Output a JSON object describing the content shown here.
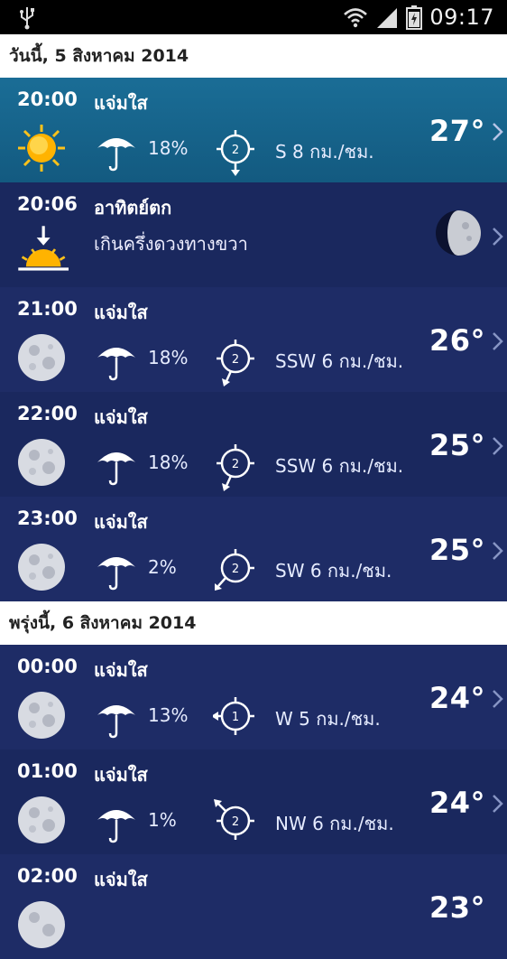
{
  "status_bar": {
    "time": "09:17",
    "icons": [
      "usb-icon",
      "wifi-icon",
      "signal-icon",
      "battery-icon"
    ]
  },
  "sections": [
    {
      "header": "วันนี้, 5 สิงหาคม 2014"
    },
    {
      "header": "พรุ่งนี้, 6 สิงหาคม 2014"
    }
  ],
  "rows": [
    {
      "time": "20:00",
      "condition": "แจ่มใส",
      "icon": "sun-icon",
      "precip": "18%",
      "wind_force": "2",
      "wind": "S 8 กม./ชม.",
      "temp": "27°"
    },
    {
      "time": "20:06",
      "condition": "อาทิตย์ตก",
      "detail": "เกินครึ่งดวงทางขวา",
      "icon": "sunset-icon",
      "moon_icon": "moon-phase-icon"
    },
    {
      "time": "21:00",
      "condition": "แจ่มใส",
      "icon": "moon-icon",
      "precip": "18%",
      "wind_force": "2",
      "wind": "SSW 6 กม./ชม.",
      "temp": "26°"
    },
    {
      "time": "22:00",
      "condition": "แจ่มใส",
      "icon": "moon-icon",
      "precip": "18%",
      "wind_force": "2",
      "wind": "SSW 6 กม./ชม.",
      "temp": "25°"
    },
    {
      "time": "23:00",
      "condition": "แจ่มใส",
      "icon": "moon-icon",
      "precip": "2%",
      "wind_force": "2",
      "wind": "SW 6 กม./ชม.",
      "temp": "25°"
    },
    {
      "time": "00:00",
      "condition": "แจ่มใส",
      "icon": "moon-icon",
      "precip": "13%",
      "wind_force": "1",
      "wind": "W 5 กม./ชม.",
      "temp": "24°"
    },
    {
      "time": "01:00",
      "condition": "แจ่มใส",
      "icon": "moon-icon",
      "precip": "1%",
      "wind_force": "2",
      "wind": "NW 6 กม./ชม.",
      "temp": "24°"
    },
    {
      "time": "02:00",
      "condition": "แจ่มใส",
      "icon": "moon-icon",
      "temp": "23°"
    }
  ],
  "colors": {
    "selected_row": "#1a6d96",
    "row_bg": "#1e2c66",
    "header_bg": "#ffffff",
    "status_bar": "#000000"
  }
}
